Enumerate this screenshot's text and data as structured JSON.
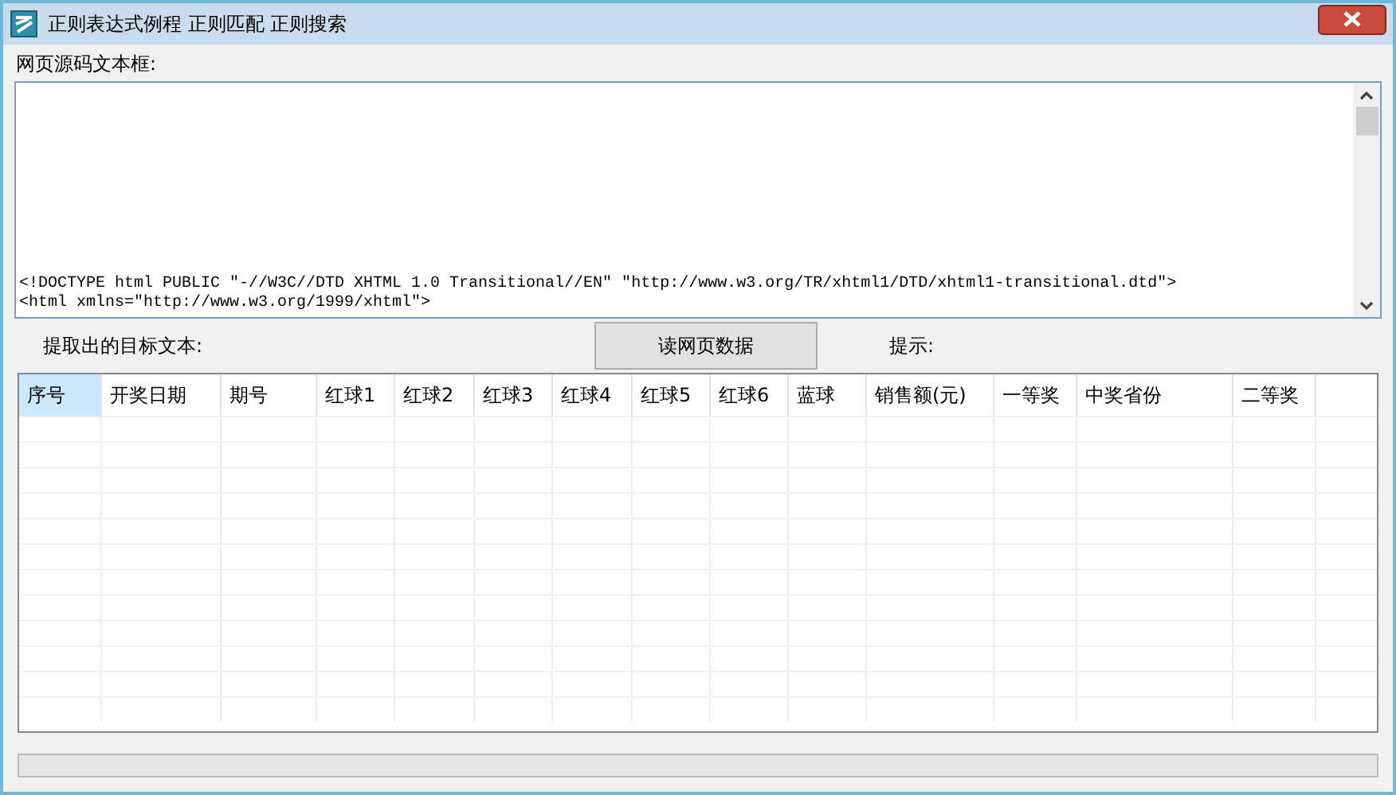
{
  "window": {
    "title": "正则表达式例程 正则匹配 正则搜索"
  },
  "source_label": "网页源码文本框:",
  "source_text": {
    "value": "<!DOCTYPE html PUBLIC \"-//W3C//DTD XHTML 1.0 Transitional//EN\" \"http://www.w3.org/TR/xhtml1/DTD/xhtml1-transitional.dtd\">\n<html xmlns=\"http://www.w3.org/1999/xhtml\">"
  },
  "extract_label": "提取出的目标文本:",
  "read_button": "读网页数据",
  "hint_label": "提示:",
  "table": {
    "columns": [
      {
        "label": "序号",
        "selected": true
      },
      {
        "label": "开奖日期",
        "selected": false
      },
      {
        "label": "期号",
        "selected": false
      },
      {
        "label": "红球1",
        "selected": false
      },
      {
        "label": "红球2",
        "selected": false
      },
      {
        "label": "红球3",
        "selected": false
      },
      {
        "label": "红球4",
        "selected": false
      },
      {
        "label": "红球5",
        "selected": false
      },
      {
        "label": "红球6",
        "selected": false
      },
      {
        "label": "蓝球",
        "selected": false
      },
      {
        "label": "销售额(元)",
        "selected": false
      },
      {
        "label": "一等奖",
        "selected": false
      },
      {
        "label": "中奖省份",
        "selected": false
      },
      {
        "label": "二等奖",
        "selected": false
      }
    ]
  },
  "progress": {
    "level": 0
  }
}
